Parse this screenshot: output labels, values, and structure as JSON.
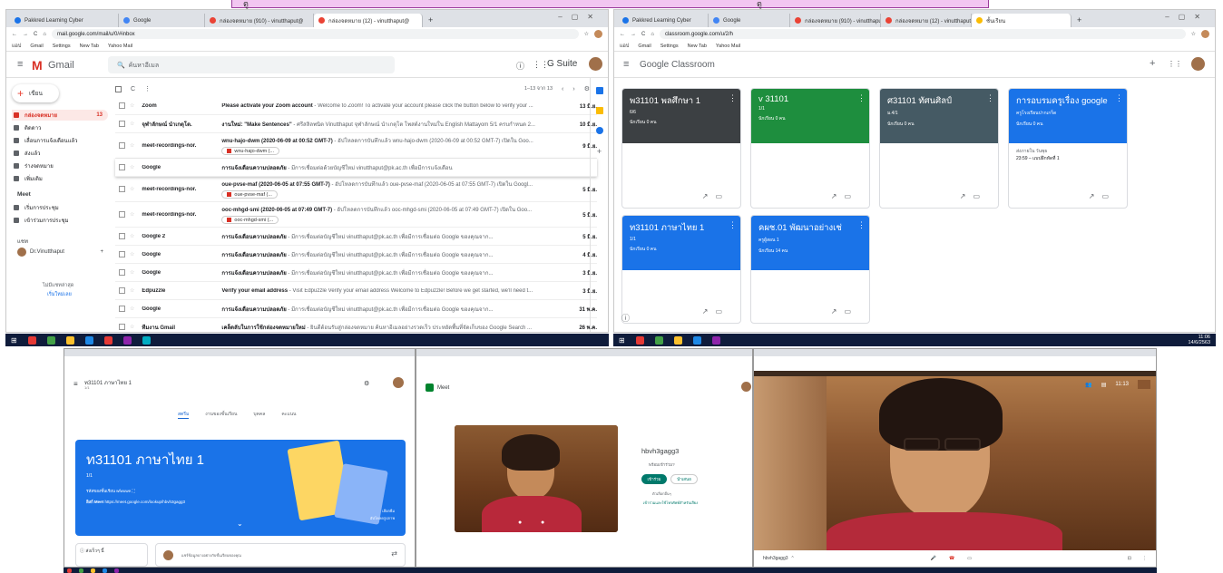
{
  "top_left_window": {
    "tabs": [
      "Pakkred Learning Cyber",
      "Google",
      "กล่องจดหมาย (910) - vinutthaput@",
      "กล่องจดหมาย (12) - vinutthaput@"
    ],
    "url": "mail.google.com/mail/u/0/#inbox",
    "bookmarks": [
      "แอป",
      "Gmail",
      "Settings",
      "New Tab",
      "Yahoo Mail"
    ],
    "app_title": "Gmail",
    "search_placeholder": "ค้นหาอีเมล",
    "gsuite": "G Suite",
    "compose": "เขียน",
    "range": "1–13 จาก 13",
    "side": [
      {
        "label": "กล่องจดหมาย",
        "count": "13"
      },
      {
        "label": "ติดดาว"
      },
      {
        "label": "เลื่อนการแจ้งเตือนแล้ว"
      },
      {
        "label": "ส่งแล้ว"
      },
      {
        "label": "ร่างจดหมาย"
      },
      {
        "label": "เพิ่มเติม"
      }
    ],
    "meet": "Meet",
    "meet_items": [
      "เริ่มการประชุม",
      "เข้าร่วมการประชุม"
    ],
    "hangouts": "แชท",
    "user": "Dr.Vinutthaput",
    "no_chats": "ไม่มีแชทล่าสุด",
    "start_new": "เริ่มใหม่เลย",
    "mails": [
      {
        "sender": "Zoom",
        "subject": "Please activate your Zoom account",
        "snippet": " - Welcome to Zoom! To activate your account please click the button below to verify your ...",
        "date": "13 มิ.ย."
      },
      {
        "sender": "จุฬาลักษณ์ นำเกตุโต.",
        "subject": "งานใหม่: \"Make Sentences\"",
        "snippet": " - ศรีสลิลพนิต Vinutthaput จุฬาลักษณ์ นำเกตุโต โพสต์งานใหม่ใน English Mattayom 5/1 ครบกำหนด 2...",
        "date": "10 มิ.ย."
      },
      {
        "sender": "meet-recordings-nor.",
        "subject": "wnu-hajo-dwm (2020-06-09 at 00:52 GMT-7)",
        "snippet": " - อัปโหลดการบันทึกแล้ว wnu-hajo-dwm (2020-06-09 at 00:52 GMT-7) เปิดใน Goo...",
        "date": "9 มิ.ย.",
        "chip": "wnu-hajo-dwm (..."
      },
      {
        "sender": "Google",
        "subject": "การแจ้งเตือนความปลอดภัย",
        "snippet": " - มีการเชื่อมต่อด้วยบัญชีใหม่ vinutthaput@pk.ac.th เพื่อมีการแจ้งเตือน",
        "date": "",
        "chip": ""
      },
      {
        "sender": "meet-recordings-nor.",
        "subject": "oue-pvse-maf (2020-06-05 at 07:55 GMT-7)",
        "snippet": " - อัปโหลดการบันทึกแล้ว oue-pvse-maf (2020-06-05 at 07:55 GMT-7) เปิดใน Googl...",
        "date": "5 มิ.ย.",
        "chip": "oue-pvse-maf (..."
      },
      {
        "sender": "meet-recordings-nor.",
        "subject": "ooc-mhgd-smi (2020-06-05 at 07:49 GMT-7)",
        "snippet": " - อัปโหลดการบันทึกแล้ว ooc-mhgd-smi (2020-06-05 at 07:49 GMT-7) เปิดใน Goo...",
        "date": "5 มิ.ย.",
        "chip": "ooc-mhgd-smi (..."
      },
      {
        "sender": "Google 2",
        "subject": "การแจ้งเตือนความปลอดภัย",
        "snippet": " - มีการเชื่อมต่อบัญชีใหม่ vinutthaput@pk.ac.th เพื่อมีการเชื่อมต่อ Google ของคุณจาก...",
        "date": "5 มิ.ย."
      },
      {
        "sender": "Google",
        "subject": "การแจ้งเตือนความปลอดภัย",
        "snippet": " - มีการเชื่อมต่อบัญชีใหม่ vinutthaput@pk.ac.th เพื่อมีการเชื่อมต่อ Google ของคุณจาก...",
        "date": "4 มิ.ย."
      },
      {
        "sender": "Google",
        "subject": "การแจ้งเตือนความปลอดภัย",
        "snippet": " - มีการเชื่อมต่อบัญชีใหม่ vinutthaput@pk.ac.th เพื่อมีการเชื่อมต่อ Google ของคุณจาก...",
        "date": "3 มิ.ย."
      },
      {
        "sender": "Edpuzzle",
        "subject": "Verify your email address",
        "snippet": " - Visit Edpuzzle Verify your email address Welcome to Edpuzzle! Before we get started, we'll need t...",
        "date": "3 มิ.ย."
      },
      {
        "sender": "Google",
        "subject": "การแจ้งเตือนความปลอดภัย",
        "snippet": " - มีการเชื่อมต่อบัญชีใหม่ vinutthaput@pk.ac.th เพื่อมีการเชื่อมต่อ Google ของคุณจาก...",
        "date": "31 พ.ค."
      },
      {
        "sender": "ทีมงาน Gmail",
        "subject": "เคล็ดลับในการใช้กล่องจดหมายใหม่",
        "snippet": " - ยินดีต้อนรับสู่กล่องจดหมาย ค้นหาอีเมลอย่างรวดเร็ว ประหยัดพื้นที่จัดเก็บของ Google Search ...",
        "date": "26 พ.ค."
      }
    ]
  },
  "top_right_window": {
    "tabs": [
      "Pakkred Learning Cyber",
      "Google",
      "กล่องจดหมาย (910) - vinutthaput@",
      "กล่องจดหมาย (12) - vinutthaput@",
      "ชั้นเรียน"
    ],
    "url": "classroom.google.com/u/2/h",
    "bookmarks": [
      "แอป",
      "Gmail",
      "Settings",
      "New Tab",
      "Yahoo Mail"
    ],
    "app_title": "Google Classroom",
    "cards": [
      {
        "title": "พ31101 พลศึกษา 1",
        "sub": "6/6",
        "students": "นักเรียน 0 คน",
        "color": "#3c4043"
      },
      {
        "title": "v 31101",
        "sub": "1/1",
        "students": "นักเรียน 0 คน",
        "color": "#1e8e3e"
      },
      {
        "title": "ศ31101 ทัศนศิลป์",
        "sub": "ม.4/1",
        "students": "นักเรียน 0 คน",
        "color": "#455a64"
      },
      {
        "title": "การอบรมครูเรื่อง google",
        "sub": "ครูโรงเรียนปากเกร็ด",
        "students": "นักเรียน 0 คน",
        "color": "#1a73e8",
        "due_label": "ส่งภายใน วันพุธ",
        "due": "23:59 – แบบฝึกหัดที่ 1"
      },
      {
        "title": "ท31101 ภาษาไทย 1",
        "sub": "1/1",
        "students": "นักเรียน 0 คน",
        "color": "#1a73e8"
      },
      {
        "title": "คผช.01 พัฒนาอย่างเช่",
        "sub": "ครูผู้สอน 1",
        "students": "นักเรียน 14 คน",
        "color": "#1a73e8"
      }
    ]
  },
  "taskbar": {
    "time": "11:06",
    "date": "14/6/2563",
    "lang": "ไทย"
  },
  "bottom_left": {
    "class_title": "ท31101 ภาษาไทย 1",
    "class_sub": "1/1",
    "tabs": [
      "สตรีม",
      "งานของชั้นเรียน",
      "บุคคล",
      "คะแนน"
    ],
    "banner_title": "ท31101 ภาษาไทย 1",
    "banner_sub": "1/1",
    "class_code_label": "รหัสของชั้นเรียน",
    "class_code": "wfwuwe",
    "meet_label": "ลิงก์ Meet",
    "meet_link": "https://meet.google.com/lookup/hbvh3gagg3",
    "select_theme": "เลือกธีม",
    "upload_photo": "อัปโหลดรูปภาพ",
    "upcoming": "ส่งเร็วๆ นี้",
    "share_placeholder": "แชร์ข้อมูลบางอย่างกับชั้นเรียนของคุณ"
  },
  "bottom_mid": {
    "meet": "Meet",
    "meeting_code": "hbvh3gagg3",
    "ready": "พร้อมเข้าร่วม?",
    "join": "เข้าร่วม",
    "present": "นำเสนอ",
    "other_options": "ตัวเลือกอื่นๆ",
    "join_phone": "เข้าร่วมและใช้โทรศัพท์สำหรับเสียง"
  },
  "bottom_right": {
    "meeting_code": "hbvh3gagg3",
    "time": "11:13",
    "tab_meet": "Meet – hbv-gagg3-m"
  }
}
